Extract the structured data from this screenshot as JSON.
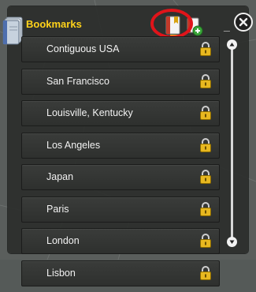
{
  "panel": {
    "title": "Bookmarks",
    "toolbar": {
      "bookmark_icon": "bookmark-book-icon",
      "add_icon": "add-bookmark-icon",
      "highlight_color": "#e0141a"
    },
    "window_controls": {
      "minimize": "_",
      "close_icon": "close-icon"
    }
  },
  "bookmarks": [
    {
      "label": "Contiguous USA",
      "icon": "lock-icon"
    },
    {
      "label": "San Francisco",
      "icon": "lock-icon"
    },
    {
      "label": "Louisville, Kentucky",
      "icon": "lock-icon"
    },
    {
      "label": "Los Angeles",
      "icon": "lock-icon"
    },
    {
      "label": "Japan",
      "icon": "lock-icon"
    },
    {
      "label": "Paris",
      "icon": "lock-icon"
    },
    {
      "label": "London",
      "icon": "lock-icon"
    },
    {
      "label": "Lisbon",
      "icon": "lock-icon"
    }
  ],
  "colors": {
    "title": "#ffd21a",
    "item_text": "#f2f2f2",
    "lock": "#e8b820"
  }
}
